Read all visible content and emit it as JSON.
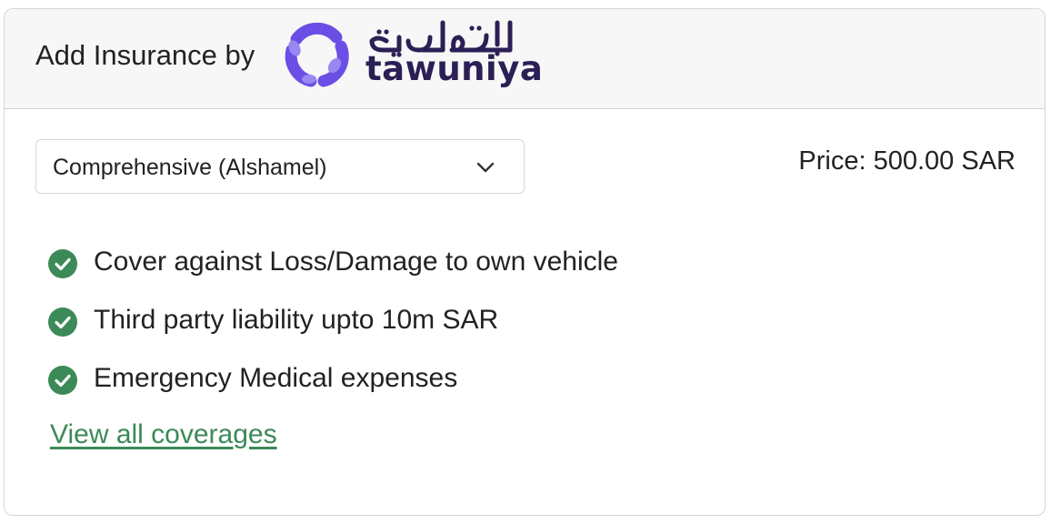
{
  "header": {
    "title": "Add Insurance by",
    "brand": {
      "arabic_name": "التعاونية",
      "latin_name": "tawuniya",
      "logo_icon": "tawuniya-logo-icon",
      "colors": {
        "primary": "#6a4ee6",
        "secondary": "#9a88f2",
        "text": "#2b1f55"
      }
    }
  },
  "plan_select": {
    "value": "Comprehensive (Alshamel)",
    "icon": "chevron-down-icon"
  },
  "price": {
    "text": "Price: 500.00 SAR"
  },
  "coverages": [
    {
      "label": "Cover against Loss/Damage to own vehicle",
      "icon": "check-circle-icon"
    },
    {
      "label": "Third party liability upto 10m SAR",
      "icon": "check-circle-icon"
    },
    {
      "label": "Emergency Medical expenses",
      "icon": "check-circle-icon"
    }
  ],
  "view_all_link": "View all coverages",
  "colors": {
    "success": "#3b8a57",
    "link": "#3b8a57",
    "border": "#d6d6d6",
    "header_bg": "#f7f7f7"
  }
}
